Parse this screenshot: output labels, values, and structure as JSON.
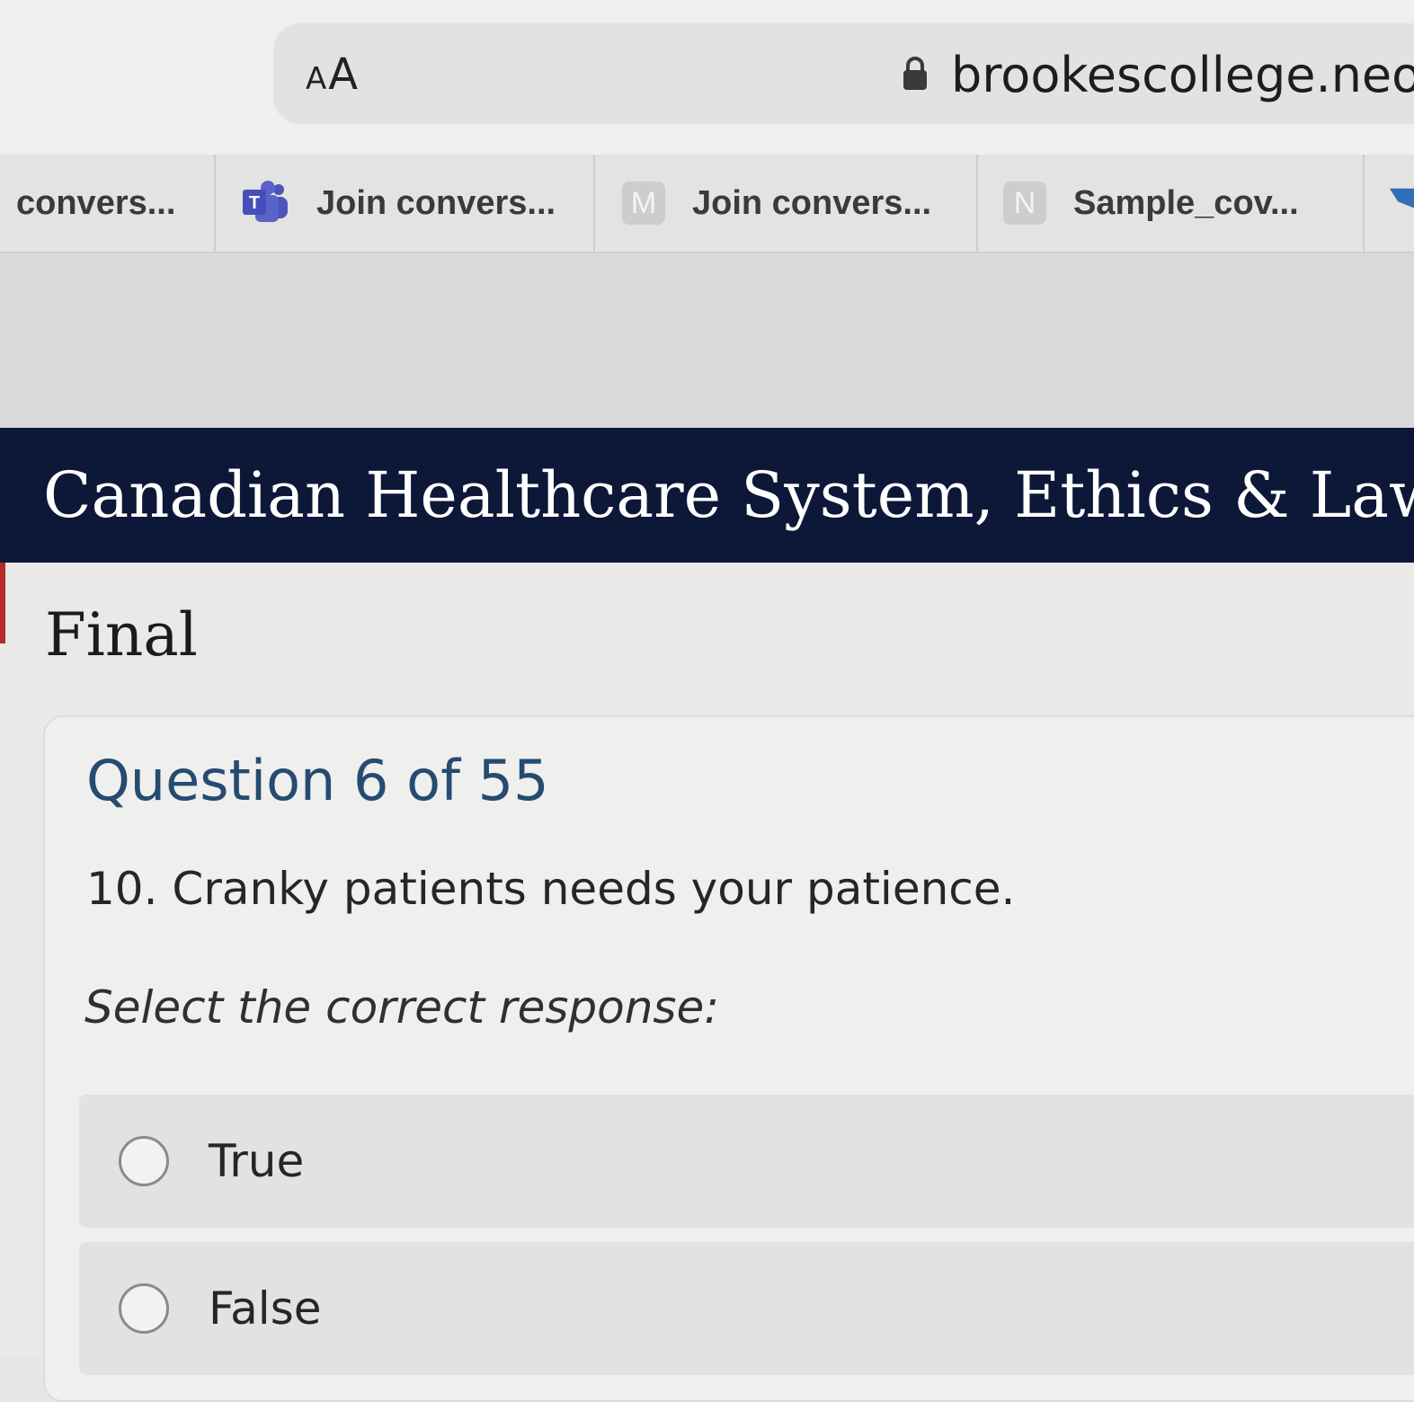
{
  "browser": {
    "text_size_button": {
      "small": "A",
      "large": "A"
    },
    "url": "brookescollege.neolr"
  },
  "tabs": [
    {
      "label": "convers...",
      "favicon": "none"
    },
    {
      "label": "Join convers...",
      "favicon": "microsoft-teams-icon"
    },
    {
      "label": "Join convers...",
      "favicon_letter": "M"
    },
    {
      "label": "Sample_cov...",
      "favicon_letter": "N"
    }
  ],
  "course": {
    "title": "Canadian Healthcare System, Ethics & Law - V"
  },
  "exam": {
    "title": "Final"
  },
  "question": {
    "heading": "Question 6 of 55",
    "text": "10. Cranky patients needs your patience.",
    "instruction": "Select the correct response:",
    "options": [
      {
        "label": "True",
        "selected": false
      },
      {
        "label": "False",
        "selected": false
      }
    ]
  },
  "colors": {
    "banner": "#0d1838",
    "question_heading": "#254b71",
    "teams_purple": "#4b53bc"
  }
}
